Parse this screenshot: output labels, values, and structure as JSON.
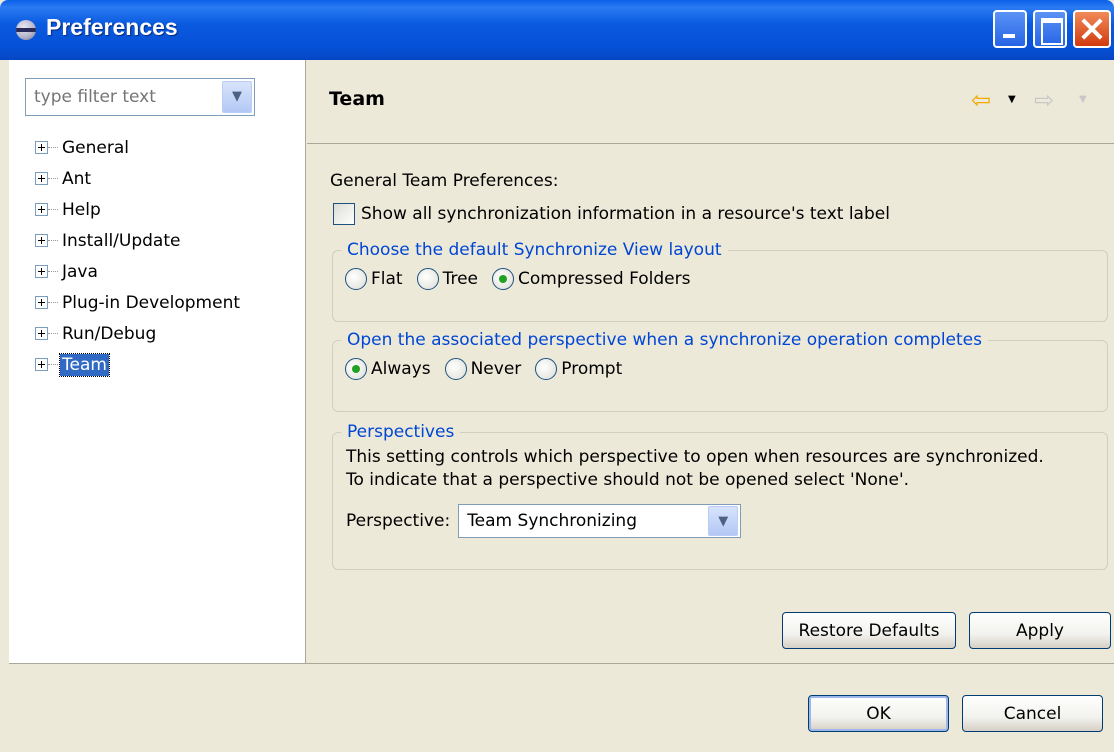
{
  "window": {
    "title": "Preferences"
  },
  "filter": {
    "placeholder": "type filter text"
  },
  "tree": {
    "items": [
      {
        "label": "General",
        "selected": false
      },
      {
        "label": "Ant",
        "selected": false
      },
      {
        "label": "Help",
        "selected": false
      },
      {
        "label": "Install/Update",
        "selected": false
      },
      {
        "label": "Java",
        "selected": false
      },
      {
        "label": "Plug-in Development",
        "selected": false
      },
      {
        "label": "Run/Debug",
        "selected": false
      },
      {
        "label": "Team",
        "selected": true
      }
    ]
  },
  "page": {
    "title": "Team",
    "general_label": "General Team Preferences:",
    "show_sync_info": {
      "label": "Show all synchronization information in a resource's text label",
      "checked": false
    },
    "layout_group": {
      "legend": "Choose the default Synchronize View layout",
      "options": [
        {
          "label": "Flat",
          "checked": false
        },
        {
          "label": "Tree",
          "checked": false
        },
        {
          "label": "Compressed Folders",
          "checked": true
        }
      ]
    },
    "open_group": {
      "legend": "Open the associated perspective when a synchronize operation completes",
      "options": [
        {
          "label": "Always",
          "checked": true
        },
        {
          "label": "Never",
          "checked": false
        },
        {
          "label": "Prompt",
          "checked": false
        }
      ]
    },
    "perspectives_group": {
      "legend": "Perspectives",
      "line1": "This setting controls which perspective to open when resources are synchronized.",
      "line2": "To indicate that a perspective should not be opened select 'None'.",
      "perspective_label": "Perspective:",
      "perspective_value": "Team Synchronizing"
    },
    "restore_defaults": "Restore Defaults",
    "apply": "Apply"
  },
  "dialog": {
    "ok": "OK",
    "cancel": "Cancel"
  }
}
